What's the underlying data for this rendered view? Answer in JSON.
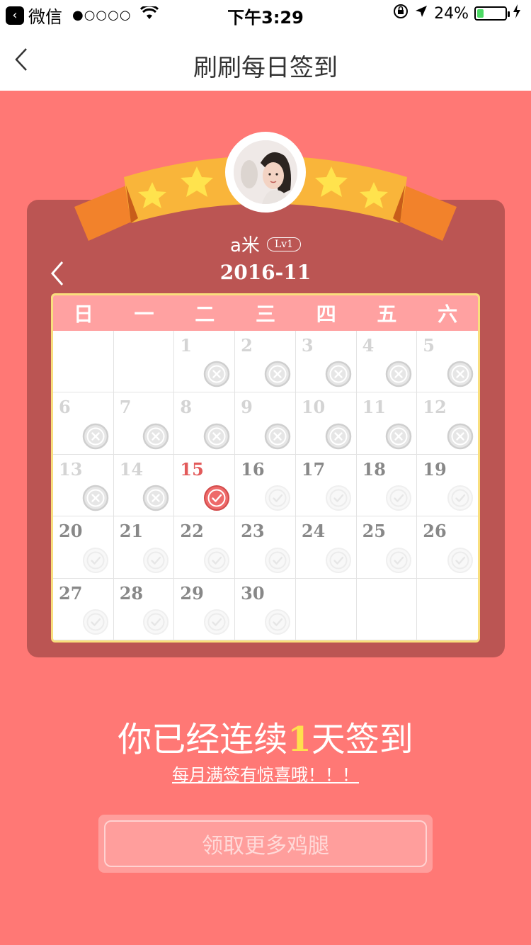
{
  "status_bar": {
    "app": "微信",
    "signal": "●○○○○",
    "time": "下午3:29",
    "battery": "24%",
    "battery_level": 0.24
  },
  "nav": {
    "title": "刷刷每日签到"
  },
  "profile": {
    "name": "a米",
    "level": "Lv1"
  },
  "calendar": {
    "month": "2016-11",
    "weekdays": [
      "日",
      "一",
      "二",
      "三",
      "四",
      "五",
      "六"
    ],
    "days": [
      {
        "num": "",
        "state": "empty"
      },
      {
        "num": "",
        "state": "empty"
      },
      {
        "num": "1",
        "state": "missed"
      },
      {
        "num": "2",
        "state": "missed"
      },
      {
        "num": "3",
        "state": "missed"
      },
      {
        "num": "4",
        "state": "missed"
      },
      {
        "num": "5",
        "state": "missed"
      },
      {
        "num": "6",
        "state": "missed"
      },
      {
        "num": "7",
        "state": "missed"
      },
      {
        "num": "8",
        "state": "missed"
      },
      {
        "num": "9",
        "state": "missed"
      },
      {
        "num": "10",
        "state": "missed"
      },
      {
        "num": "11",
        "state": "missed"
      },
      {
        "num": "12",
        "state": "missed"
      },
      {
        "num": "13",
        "state": "missed"
      },
      {
        "num": "14",
        "state": "missed"
      },
      {
        "num": "15",
        "state": "today"
      },
      {
        "num": "16",
        "state": "future"
      },
      {
        "num": "17",
        "state": "future"
      },
      {
        "num": "18",
        "state": "future"
      },
      {
        "num": "19",
        "state": "future"
      },
      {
        "num": "20",
        "state": "future"
      },
      {
        "num": "21",
        "state": "future"
      },
      {
        "num": "22",
        "state": "future"
      },
      {
        "num": "23",
        "state": "future"
      },
      {
        "num": "24",
        "state": "future"
      },
      {
        "num": "25",
        "state": "future"
      },
      {
        "num": "26",
        "state": "future"
      },
      {
        "num": "27",
        "state": "future"
      },
      {
        "num": "28",
        "state": "future"
      },
      {
        "num": "29",
        "state": "future"
      },
      {
        "num": "30",
        "state": "future"
      },
      {
        "num": "",
        "state": "empty"
      },
      {
        "num": "",
        "state": "empty"
      },
      {
        "num": "",
        "state": "empty"
      }
    ]
  },
  "streak": {
    "prefix": "你已经连续",
    "count": "1",
    "suffix": "天签到"
  },
  "surprise_link": "每月满签有惊喜哦！！！",
  "claim_button": "领取更多鸡腿",
  "colors": {
    "background": "#ff7875",
    "card": "#bb5553",
    "weekday_header": "#ffa1a1",
    "calendar_border": "#f9df7d",
    "streak_highlight": "#ffe04d",
    "today": "#e25a5a"
  }
}
